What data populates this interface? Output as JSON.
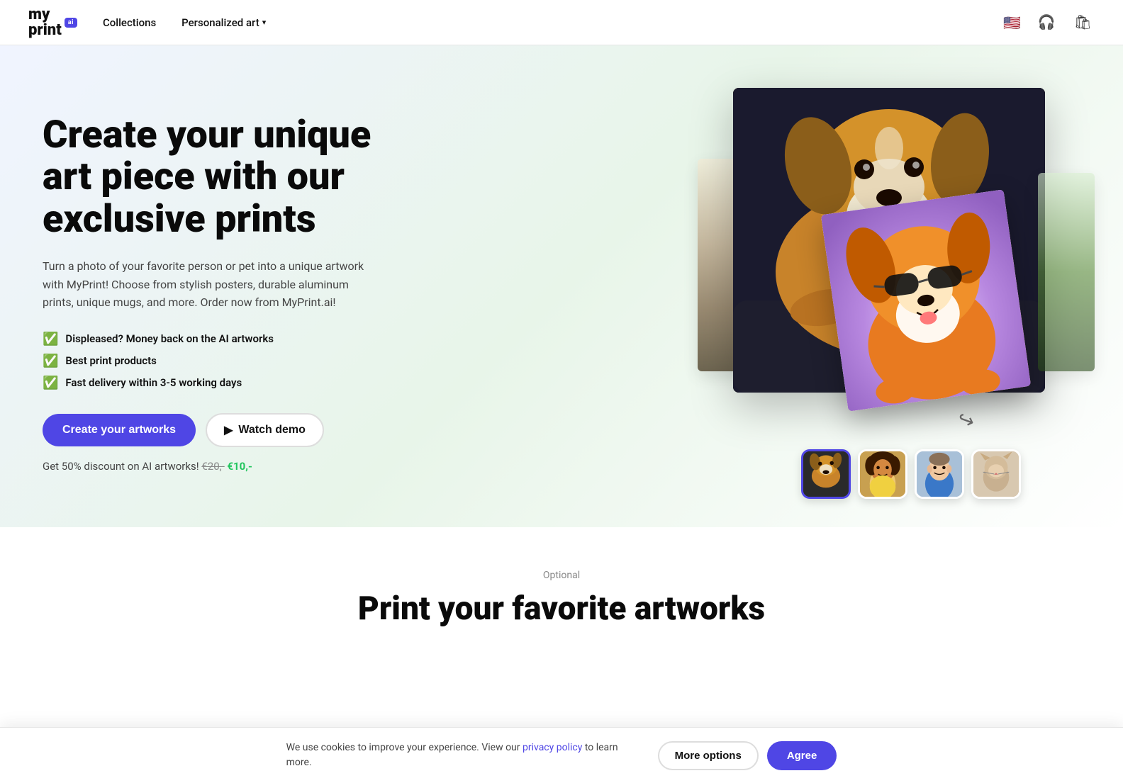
{
  "nav": {
    "logo_line1": "my",
    "logo_line2": "print",
    "logo_badge": "ai",
    "collections_label": "Collections",
    "personalized_art_label": "Personalized art",
    "flag_emoji": "🇺🇸"
  },
  "hero": {
    "title": "Create your unique art piece with our exclusive prints",
    "description": "Turn a photo of your favorite person or pet into a unique artwork with MyPrint! Choose from stylish posters, durable aluminum prints, unique mugs, and more. Order now from MyPrint.ai!",
    "checks": [
      "Displeased? Money back on the AI artworks",
      "Best print products",
      "Fast delivery within 3-5 working days"
    ],
    "cta_primary": "Create your artworks",
    "cta_secondary": "Watch demo",
    "discount_prefix": "Get 50% discount on AI artworks!",
    "price_old": "€20,-",
    "price_new": "€10,-"
  },
  "thumbnails": [
    {
      "id": "thumb-dog",
      "emoji": "🐶",
      "active": true
    },
    {
      "id": "thumb-child",
      "emoji": "👧",
      "active": false
    },
    {
      "id": "thumb-man",
      "emoji": "👨",
      "active": false
    },
    {
      "id": "thumb-cat",
      "emoji": "🐱",
      "active": false
    }
  ],
  "section2": {
    "label": "Optional",
    "title": "Print your favorite artworks"
  },
  "cookie": {
    "message": "We use cookies to improve your experience. View our privacy policy to learn more.",
    "privacy_link": "privacy policy",
    "more_options_label": "More options",
    "agree_label": "Agree"
  }
}
